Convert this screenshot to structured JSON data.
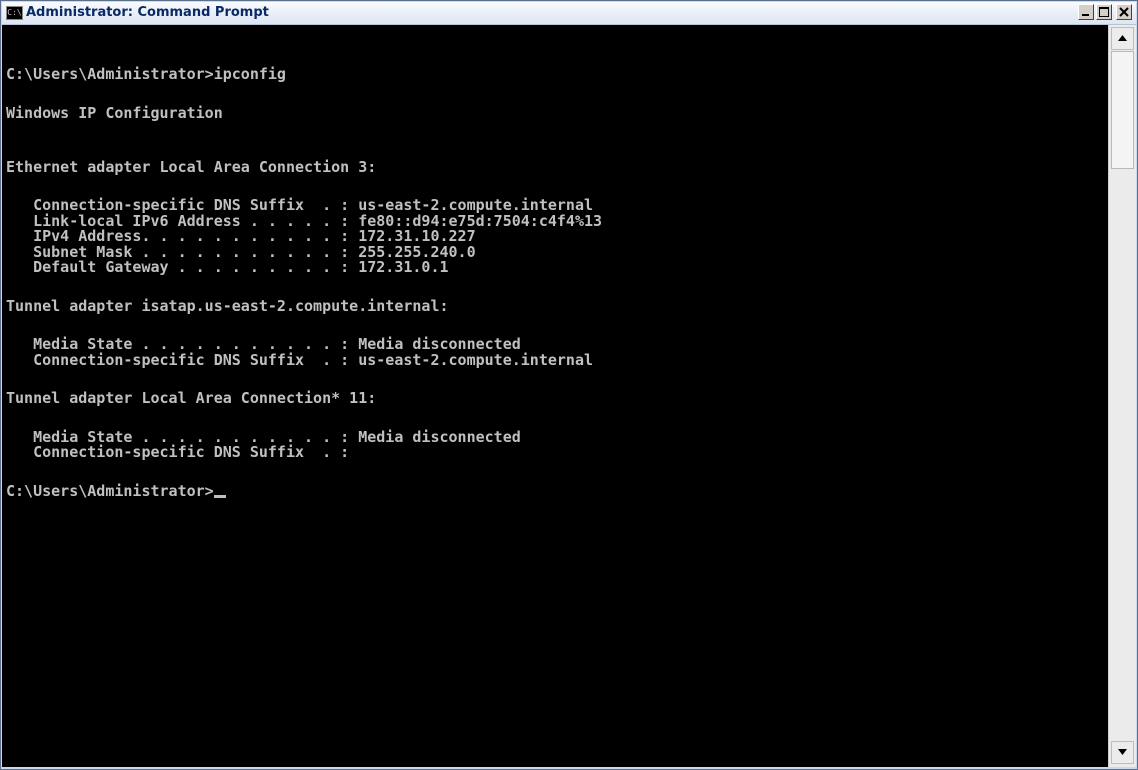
{
  "window": {
    "title": "Administrator: Command Prompt",
    "icon_name": "console-app-icon",
    "icon_text": "C:\\"
  },
  "console": {
    "lines": [
      "C:\\Users\\Administrator>ipconfig",
      "",
      "Windows IP Configuration",
      "",
      "",
      "Ethernet adapter Local Area Connection 3:",
      "",
      "   Connection-specific DNS Suffix  . : us-east-2.compute.internal",
      "   Link-local IPv6 Address . . . . . : fe80::d94:e75d:7504:c4f4%13",
      "   IPv4 Address. . . . . . . . . . . : 172.31.10.227",
      "   Subnet Mask . . . . . . . . . . . : 255.255.240.0",
      "   Default Gateway . . . . . . . . . : 172.31.0.1",
      "",
      "Tunnel adapter isatap.us-east-2.compute.internal:",
      "",
      "   Media State . . . . . . . . . . . : Media disconnected",
      "   Connection-specific DNS Suffix  . : us-east-2.compute.internal",
      "",
      "Tunnel adapter Local Area Connection* 11:",
      "",
      "   Media State . . . . . . . . . . . : Media disconnected",
      "   Connection-specific DNS Suffix  . :",
      "",
      "C:\\Users\\Administrator>"
    ]
  },
  "colors": {
    "console_background": "#000000",
    "console_text": "#c0c0c0",
    "title_text": "#0a2a66"
  }
}
